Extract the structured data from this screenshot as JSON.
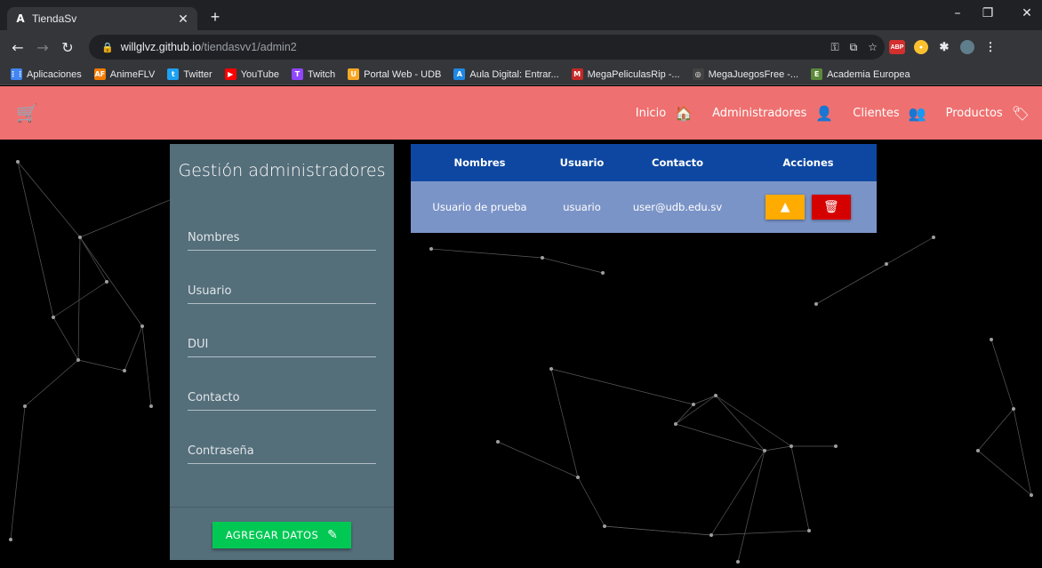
{
  "browser": {
    "tab_title": "TiendaSv",
    "tab_favicon": "A",
    "url_host": "willglvz.github.io",
    "url_path": "/tiendasvv1/admin2",
    "bookmarks": [
      {
        "label": "Aplicaciones",
        "icon": "apps-grid-icon",
        "color": "#4285f4",
        "glyph": "⋮⋮"
      },
      {
        "label": "AnimeFLV",
        "icon": "animeflv-icon",
        "color": "#f57c00",
        "glyph": "AF"
      },
      {
        "label": "Twitter",
        "icon": "twitter-icon",
        "color": "#1da1f2",
        "glyph": "t"
      },
      {
        "label": "YouTube",
        "icon": "youtube-icon",
        "color": "#ff0000",
        "glyph": "▶"
      },
      {
        "label": "Twitch",
        "icon": "twitch-icon",
        "color": "#9146ff",
        "glyph": "T"
      },
      {
        "label": "Portal Web - UDB",
        "icon": "udb-icon",
        "color": "#f9a825",
        "glyph": "U"
      },
      {
        "label": "Aula Digital: Entrar...",
        "icon": "aula-icon",
        "color": "#1e88e5",
        "glyph": "A"
      },
      {
        "label": "MegaPeliculasRip -...",
        "icon": "megapeliculas-icon",
        "color": "#c62828",
        "glyph": "M"
      },
      {
        "label": "MegaJuegosFree -...",
        "icon": "gamepad-icon",
        "color": "#424242",
        "glyph": "◎"
      },
      {
        "label": "Academia Europea",
        "icon": "academia-icon",
        "color": "#5c8a3a",
        "glyph": "E"
      }
    ]
  },
  "navbar": {
    "links": [
      {
        "label": "Inicio",
        "icon": "home-icon",
        "glyph": "🏠"
      },
      {
        "label": "Administradores",
        "icon": "person-icon",
        "glyph": "👤"
      },
      {
        "label": "Clientes",
        "icon": "people-icon",
        "glyph": "👥"
      },
      {
        "label": "Productos",
        "icon": "tag-icon",
        "glyph": "🏷"
      }
    ]
  },
  "form": {
    "title": "Gestión administradores",
    "fields": [
      {
        "name": "nombres",
        "placeholder": "Nombres"
      },
      {
        "name": "usuario",
        "placeholder": "Usuario"
      },
      {
        "name": "dui",
        "placeholder": "DUI"
      },
      {
        "name": "contacto",
        "placeholder": "Contacto"
      },
      {
        "name": "contrasena",
        "placeholder": "Contraseña"
      }
    ],
    "submit_label": "AGREGAR DATOS"
  },
  "table": {
    "headers": [
      "Nombres",
      "Usuario",
      "Contacto",
      "Acciones"
    ],
    "rows": [
      {
        "nombres": "Usuario de prueba",
        "usuario": "usuario",
        "contacto": "user@udb.edu.sv"
      }
    ]
  },
  "colors": {
    "navbar": "#ef7070",
    "panel": "#546e7a",
    "table_header": "#0d47a1",
    "table_row": "#7b94c7",
    "add_button": "#00c853",
    "edit_button": "#ffab00",
    "delete_button": "#d50000"
  }
}
